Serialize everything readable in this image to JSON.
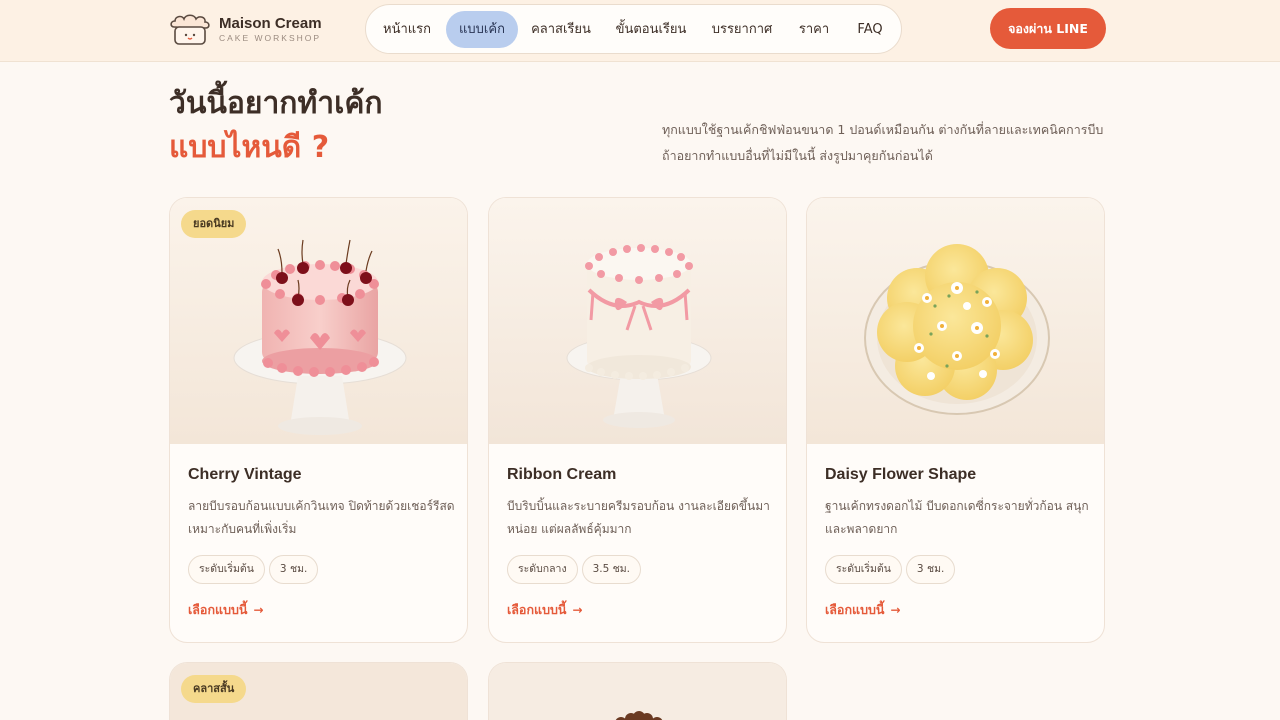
{
  "brand": {
    "name": "Maison Cream",
    "tagline": "CAKE WORKSHOP",
    "logo_icon": "cake-cloud-icon"
  },
  "nav": {
    "items": [
      {
        "label": "หน้าแรก",
        "active": false
      },
      {
        "label": "แบบเค้ก",
        "active": true
      },
      {
        "label": "คลาสเรียน",
        "active": false
      },
      {
        "label": "ขั้นตอนเรียน",
        "active": false
      },
      {
        "label": "บรรยากาศ",
        "active": false
      },
      {
        "label": "ราคา",
        "active": false
      },
      {
        "label": "FAQ",
        "active": false
      }
    ],
    "cta_label": "จองผ่าน LINE"
  },
  "hero": {
    "title_line1": "วันนี้อยากทำเค้ก",
    "title_line2": "แบบไหนดี ?",
    "description_line1": "ทุกแบบใช้ฐานเค้กชิฟฟ่อนขนาด 1 ปอนด์เหมือนกัน ต่างกันที่ลายและเทคนิคการบีบ",
    "description_line2": "ถ้าอยากทำแบบอื่นที่ไม่มีในนี้ ส่งรูปมาคุยกันก่อนได้"
  },
  "cards": [
    {
      "badge": "ยอดนิยม",
      "title": "Cherry Vintage",
      "desc_line1": "ลายบีบรอบก้อนแบบเค้กวินเทจ ปิดท้ายด้วยเชอร์รีสด",
      "desc_line2": "เหมาะกับคนที่เพิ่งเริ่ม",
      "level": "ระดับเริ่มต้น",
      "duration": "3 ชม.",
      "link": "เลือกแบบนี้",
      "image": "cherry-vintage-cake"
    },
    {
      "badge": "",
      "title": "Ribbon Cream",
      "desc_line1": "บีบริบบิ้นและระบายครีมรอบก้อน งานละเอียดขึ้นมา",
      "desc_line2": "หน่อย แต่ผลลัพธ์คุ้มมาก",
      "level": "ระดับกลาง",
      "duration": "3.5 ชม.",
      "link": "เลือกแบบนี้",
      "image": "ribbon-cream-cake"
    },
    {
      "badge": "",
      "title": "Daisy Flower Shape",
      "desc_line1": "ฐานเค้กทรงดอกไม้ บีบดอกเดซี่กระจายทั่วก้อน สนุก",
      "desc_line2": "และพลาดยาก",
      "level": "ระดับเริ่มต้น",
      "duration": "3 ชม.",
      "link": "เลือกแบบนี้",
      "image": "daisy-flower-cake"
    },
    {
      "badge": "คลาสสั้น",
      "title": "",
      "image": "short-class-cake"
    },
    {
      "badge": "",
      "title": "",
      "image": "chocolate-cake"
    }
  ],
  "colors": {
    "accent": "#e55a3a",
    "nav_active": "#b9cdee",
    "badge": "#f5d98c",
    "background": "#fdf8f3"
  }
}
